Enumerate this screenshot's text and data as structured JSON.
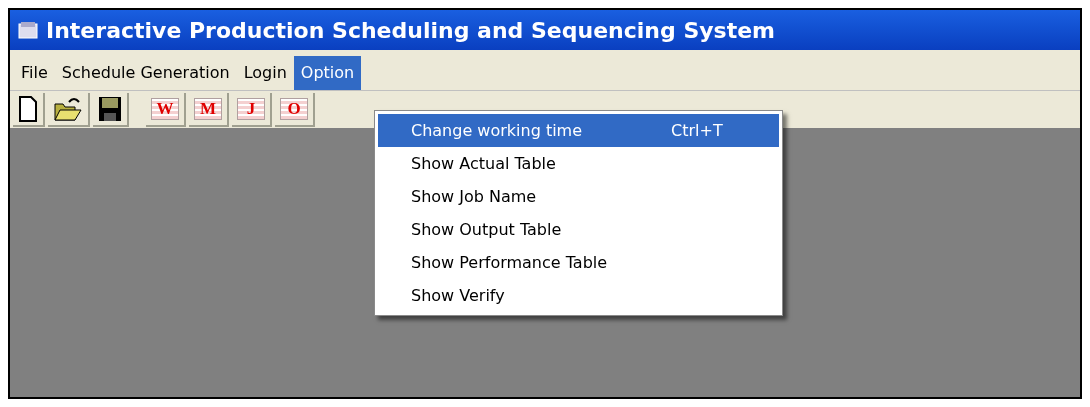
{
  "window": {
    "title": "Interactive Production Scheduling and Sequencing System"
  },
  "menu_bar": [
    {
      "label": "File",
      "selected": false
    },
    {
      "label": "Schedule Generation",
      "selected": false
    },
    {
      "label": "Login",
      "selected": false
    },
    {
      "label": "Option",
      "selected": true
    }
  ],
  "toolbar": [
    {
      "kind": "new"
    },
    {
      "kind": "open"
    },
    {
      "kind": "save"
    },
    {
      "kind": "grid",
      "letter": "W"
    },
    {
      "kind": "grid",
      "letter": "M"
    },
    {
      "kind": "grid",
      "letter": "J"
    },
    {
      "kind": "grid",
      "letter": "O"
    }
  ],
  "dropdown": [
    {
      "label": "Change working time",
      "shortcut": "Ctrl+T",
      "selected": true
    },
    {
      "label": "Show Actual Table",
      "selected": false
    },
    {
      "label": "Show Job Name",
      "selected": false
    },
    {
      "label": "Show Output Table",
      "selected": false
    },
    {
      "label": "Show Performance Table",
      "selected": false
    },
    {
      "label": "Show Verify",
      "selected": false
    }
  ]
}
